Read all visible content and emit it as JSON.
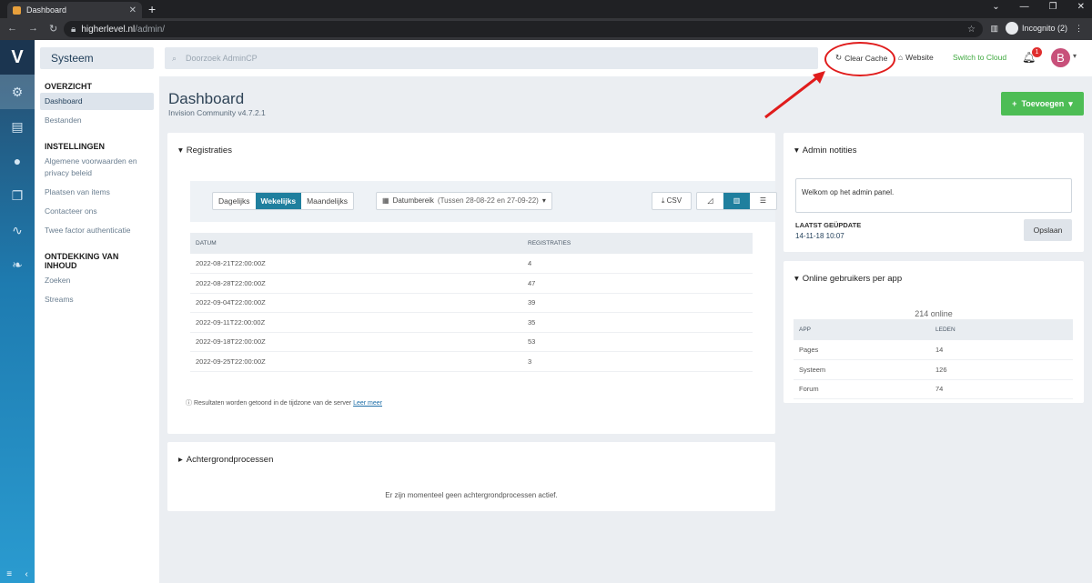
{
  "browser": {
    "tab_title": "Dashboard",
    "url_host": "higherlevel.nl",
    "url_path": "/admin/",
    "profile": "Incognito (2)"
  },
  "rail": {
    "items": [
      "settings-icon",
      "document-icon",
      "user-icon",
      "copy-icon",
      "chart-icon",
      "leaf-icon"
    ]
  },
  "sidebar": {
    "app": "Systeem",
    "sections": [
      {
        "title": "OVERZICHT",
        "items": [
          "Dashboard",
          "Bestanden"
        ]
      },
      {
        "title": "INSTELLINGEN",
        "items": [
          "Algemene voorwaarden en privacy beleid",
          "Plaatsen van items",
          "Contacteer ons",
          "Twee factor authenticatie"
        ]
      },
      {
        "title": "ONTDEKKING VAN INHOUD",
        "items": [
          "Zoeken",
          "Streams"
        ]
      }
    ]
  },
  "header": {
    "search_placeholder": "Doorzoek AdminCP",
    "clear_cache": "Clear Cache",
    "website": "Website",
    "switch_cloud": "Switch to Cloud",
    "notif_count": "1",
    "avatar_letter": "B"
  },
  "page": {
    "title": "Dashboard",
    "subtitle": "Invision Community v4.7.2.1",
    "add_button": "Toevoegen"
  },
  "registraties": {
    "title": "Registraties",
    "tabs": [
      "Dagelijks",
      "Wekelijks",
      "Maandelijks"
    ],
    "active_tab": "Wekelijks",
    "date_label": "Datumbereik",
    "date_range": "(Tussen 28-08-22 en 27-09-22)",
    "csv": "CSV",
    "columns": [
      "DATUM",
      "REGISTRATIES"
    ],
    "rows": [
      [
        "2022-08-21T22:00:00Z",
        "4"
      ],
      [
        "2022-08-28T22:00:00Z",
        "47"
      ],
      [
        "2022-09-04T22:00:00Z",
        "39"
      ],
      [
        "2022-09-11T22:00:00Z",
        "35"
      ],
      [
        "2022-09-18T22:00:00Z",
        "53"
      ],
      [
        "2022-09-25T22:00:00Z",
        "3"
      ]
    ],
    "note": "Resultaten worden getoond in de tijdzone van de server",
    "note_link": "Leer meer"
  },
  "achtergrond": {
    "title": "Achtergrondprocessen",
    "empty": "Er zijn momenteel geen achtergrondprocessen actief."
  },
  "admin_notities": {
    "title": "Admin notities",
    "text": "Welkom op het admin panel.",
    "last_label": "LAATST GEÜPDATE",
    "last_value": "14-11-18 10:07",
    "save": "Opslaan"
  },
  "online": {
    "title": "Online gebruikers per app",
    "count": "214 online",
    "columns": [
      "APP",
      "LEDEN"
    ],
    "rows": [
      [
        "Pages",
        "14"
      ],
      [
        "Systeem",
        "126"
      ],
      [
        "Forum",
        "74"
      ]
    ]
  },
  "colors": {
    "accent": "#1f7f9e",
    "green": "#4dbd55",
    "annotation": "#e01c1c"
  }
}
